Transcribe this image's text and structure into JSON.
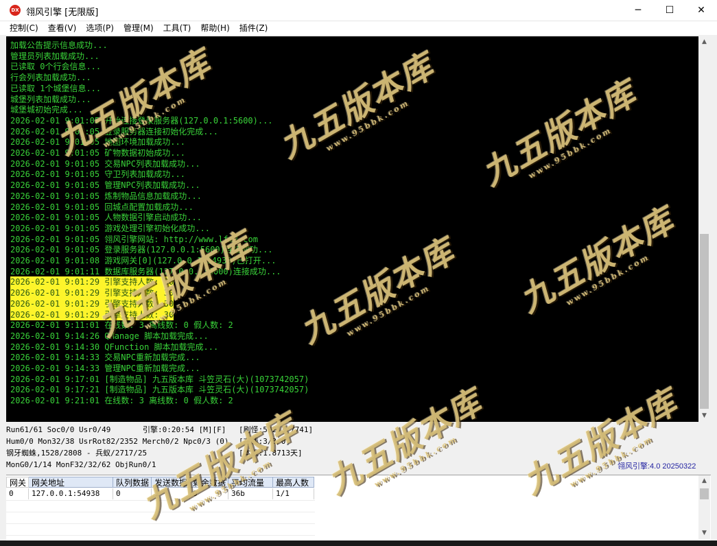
{
  "window": {
    "app_icon_text": "DX",
    "title": "翎风引擎 [无限版]",
    "minimize": "─",
    "maximize": "☐",
    "close": "✕"
  },
  "menu": [
    {
      "label": "控制(C)"
    },
    {
      "label": "查看(V)"
    },
    {
      "label": "选项(P)"
    },
    {
      "label": "管理(M)"
    },
    {
      "label": "工具(T)"
    },
    {
      "label": "帮助(H)"
    },
    {
      "label": "插件(Z)"
    }
  ],
  "log": [
    {
      "text": "加载公告提示信息成功...",
      "hl": false
    },
    {
      "text": "管理员列表加载成功...",
      "hl": false
    },
    {
      "text": "已读取 0个行会信息...",
      "hl": false
    },
    {
      "text": "行会列表加载成功...",
      "hl": false
    },
    {
      "text": "已读取 1个城堡信息...",
      "hl": false
    },
    {
      "text": "城堡列表加载成功...",
      "hl": false
    },
    {
      "text": "城堡城初始完成...",
      "hl": false
    },
    {
      "text": "2026-02-01 9:01:05 开始连接登录服务器(127.0.0.1:5600)...",
      "hl": false
    },
    {
      "text": "2026-02-01 9:01:05 登录服务器连接初始化完成...",
      "hl": false
    },
    {
      "text": "2026-02-01 9:01:05 地图环境加载成功...",
      "hl": false
    },
    {
      "text": "2026-02-01 9:01:05 矿物数据初始成功...",
      "hl": false
    },
    {
      "text": "2026-02-01 9:01:05 交易NPC列表加载成功...",
      "hl": false
    },
    {
      "text": "2026-02-01 9:01:05 守卫列表加载成功...",
      "hl": false
    },
    {
      "text": "2026-02-01 9:01:05 管理NPC列表加载成功...",
      "hl": false
    },
    {
      "text": "2026-02-01 9:01:05 炼制物品信息加载成功...",
      "hl": false
    },
    {
      "text": "2026-02-01 9:01:05 回城点配置加载成功...",
      "hl": false
    },
    {
      "text": "2026-02-01 9:01:05 人物数据引擎启动成功...",
      "hl": false
    },
    {
      "text": "2026-02-01 9:01:05 游戏处理引擎初始化成功...",
      "hl": false
    },
    {
      "text": "2026-02-01 9:01:05 翎风引擎网站: http://www.lfm2.com",
      "hl": false
    },
    {
      "text": "2026-02-01 9:01:05 登录服务器(127.0.0.1:5600)连接成功...",
      "hl": false
    },
    {
      "text": "2026-02-01 9:01:08 游戏网关[0](127.0.0.1:54938)已打开...",
      "hl": false
    },
    {
      "text": "2026-02-01 9:01:11 数据库服务器(127.0.0.1:6000)连接成功...",
      "hl": false
    },
    {
      "text": "2026-02-01 9:01:29 引擎支持人数: 30",
      "hl": true
    },
    {
      "text": "2026-02-01 9:01:29 引擎支持人数: 30",
      "hl": true
    },
    {
      "text": "2026-02-01 9:01:29 引擎支持人数: 30",
      "hl": true
    },
    {
      "text": "2026-02-01 9:01:29 引擎支持人数: 30",
      "hl": true
    },
    {
      "text": "2026-02-01 9:11:01 在线数: 3 离线数: 0 假人数: 2",
      "hl": false
    },
    {
      "text": "2026-02-01 9:14:26 QManage 脚本加载完成...",
      "hl": false
    },
    {
      "text": "2026-02-01 9:14:30 QFunction 脚本加载完成...",
      "hl": false
    },
    {
      "text": "2026-02-01 9:14:33 交易NPC重新加载完成...",
      "hl": false
    },
    {
      "text": "2026-02-01 9:14:33 管理NPC重新加载完成...",
      "hl": false
    },
    {
      "text": "2026-02-01 9:17:01 [制造物品] 九五版本库 斗笠灵石(大)(1073742057)",
      "hl": false
    },
    {
      "text": "2026-02-01 9:17:21 [制造物品] 九五版本库 斗笠灵石(大)(1073742057)",
      "hl": false
    },
    {
      "text": "2026-02-01 9:21:01 在线数: 3 离线数: 0 假人数: 2",
      "hl": false
    }
  ],
  "status": {
    "line1_left": "Run61/61 Soc0/0 Usr0/49",
    "line1_mid": "引擎:0:20:54 [M][F]",
    "line1_right": "[刷怪:59213/7741]",
    "line2_left": "Hum0/0 Mon32/38 UsrRot82/2352 Merch0/2 Npc0/3 (0)",
    "line2_right": "[在线:3/3/0]",
    "line3_left": "钢牙蜘蛛,1528/2808 - 兵蚁/2717/25",
    "line3_right": "[本机:1.8713天]",
    "line4_left": "MonG0/1/14 MonF32/32/62 ObjRun0/1",
    "version": "翎风引擎:4.0 20250322"
  },
  "gateway": {
    "headers": [
      "网关",
      "网关地址",
      "队列数据",
      "发送数据",
      "剩余数据",
      "平均流量",
      "最高人数"
    ],
    "rows": [
      [
        "0",
        "127.0.0.1:54938",
        "0",
        "1",
        "0",
        "36b",
        "1/1"
      ]
    ]
  },
  "watermark": {
    "main": "九五版本库",
    "sub": "www.95bbk.com"
  }
}
